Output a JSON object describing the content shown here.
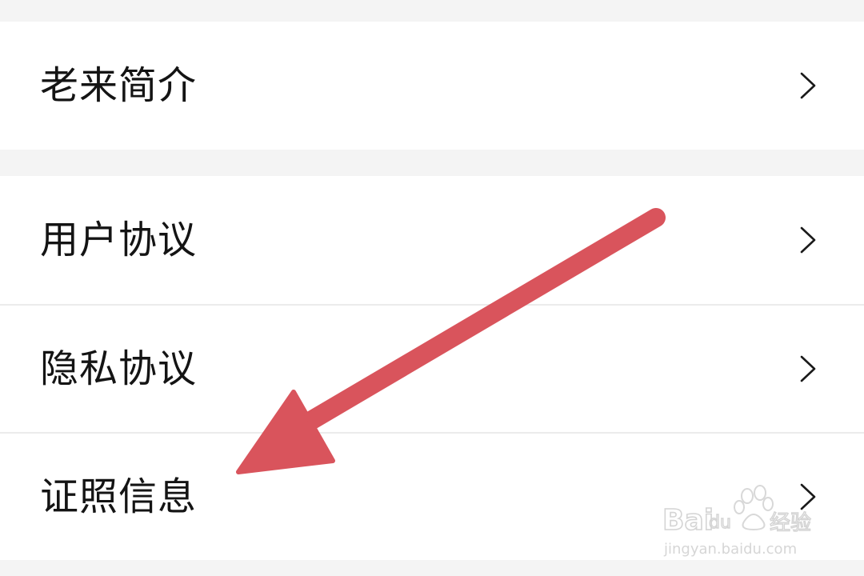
{
  "menu": {
    "group1": [
      {
        "label": "老来简介",
        "icon": "chevron-right-icon"
      }
    ],
    "group2": [
      {
        "label": "用户协议",
        "icon": "chevron-right-icon"
      },
      {
        "label": "隐私协议",
        "icon": "chevron-right-icon"
      },
      {
        "label": "证照信息",
        "icon": "chevron-right-icon"
      }
    ]
  },
  "annotation": {
    "arrow_color": "#d9545c"
  },
  "watermark": {
    "brand": "Bai du 经验",
    "url": "jingyan.baidu.com"
  },
  "colors": {
    "background": "#f4f4f4",
    "row_background": "#ffffff",
    "separator": "#ebebeb",
    "text": "#141414"
  }
}
